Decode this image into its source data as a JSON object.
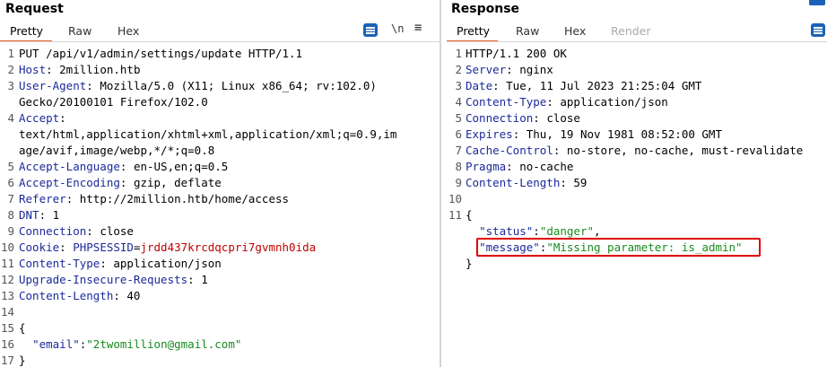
{
  "request": {
    "title": "Request",
    "tabs": [
      "Pretty",
      "Raw",
      "Hex"
    ],
    "active_tab": "Pretty",
    "toolbar": {
      "newline_glyph": "\\n",
      "menu_glyph": "≡",
      "icons": [
        "text-options-icon",
        "newline-toggle-icon",
        "menu-icon"
      ]
    },
    "lines": [
      {
        "n": "1",
        "parts": [
          {
            "t": "PUT /api/v1/admin/settings/update HTTP/1.1",
            "c": "v"
          }
        ]
      },
      {
        "n": "2",
        "parts": [
          {
            "t": "Host",
            "c": "k"
          },
          {
            "t": ": 2million.htb",
            "c": "v"
          }
        ]
      },
      {
        "n": "3",
        "parts": [
          {
            "t": "User-Agent",
            "c": "k"
          },
          {
            "t": ": Mozilla/5.0 (X11; Linux x86_64; rv:102.0)",
            "c": "v"
          }
        ]
      },
      {
        "n": "",
        "parts": [
          {
            "t": "Gecko/20100101 Firefox/102.0",
            "c": "v"
          }
        ]
      },
      {
        "n": "4",
        "parts": [
          {
            "t": "Accept",
            "c": "k"
          },
          {
            "t": ":",
            "c": "v"
          }
        ]
      },
      {
        "n": "",
        "parts": [
          {
            "t": "text/html,application/xhtml+xml,application/xml;q=0.9,im",
            "c": "v"
          }
        ]
      },
      {
        "n": "",
        "parts": [
          {
            "t": "age/avif,image/webp,*/*;q=0.8",
            "c": "v"
          }
        ]
      },
      {
        "n": "5",
        "parts": [
          {
            "t": "Accept-Language",
            "c": "k"
          },
          {
            "t": ": en-US,en;q=0.5",
            "c": "v"
          }
        ]
      },
      {
        "n": "6",
        "parts": [
          {
            "t": "Accept-Encoding",
            "c": "k"
          },
          {
            "t": ": gzip, deflate",
            "c": "v"
          }
        ]
      },
      {
        "n": "7",
        "parts": [
          {
            "t": "Referer",
            "c": "k"
          },
          {
            "t": ": http://2million.htb/home/access",
            "c": "v"
          }
        ]
      },
      {
        "n": "8",
        "parts": [
          {
            "t": "DNT",
            "c": "k"
          },
          {
            "t": ": 1",
            "c": "v"
          }
        ]
      },
      {
        "n": "9",
        "parts": [
          {
            "t": "Connection",
            "c": "k"
          },
          {
            "t": ": close",
            "c": "v"
          }
        ]
      },
      {
        "n": "10",
        "parts": [
          {
            "t": "Cookie",
            "c": "k"
          },
          {
            "t": ": ",
            "c": "v"
          },
          {
            "t": "PHPSESSID",
            "c": "ck"
          },
          {
            "t": "=",
            "c": "v"
          },
          {
            "t": "jrdd437krcdqcpri7gvmnh0ida",
            "c": "cv"
          }
        ]
      },
      {
        "n": "11",
        "parts": [
          {
            "t": "Content-Type",
            "c": "k"
          },
          {
            "t": ": application/json",
            "c": "v"
          }
        ]
      },
      {
        "n": "12",
        "parts": [
          {
            "t": "Upgrade-Insecure-Requests",
            "c": "k"
          },
          {
            "t": ": 1",
            "c": "v"
          }
        ]
      },
      {
        "n": "13",
        "parts": [
          {
            "t": "Content-Length",
            "c": "k"
          },
          {
            "t": ": 40",
            "c": "v"
          }
        ]
      },
      {
        "n": "14",
        "parts": []
      },
      {
        "n": "15",
        "parts": [
          {
            "t": "{",
            "c": "p"
          }
        ]
      },
      {
        "n": "16",
        "parts": [
          {
            "t": "  ",
            "c": "p"
          },
          {
            "t": "\"email\"",
            "c": "jk"
          },
          {
            "t": ":",
            "c": "p"
          },
          {
            "t": "\"2twomillion@gmail.com\"",
            "c": "jv"
          }
        ]
      },
      {
        "n": "17",
        "parts": [
          {
            "t": "}",
            "c": "p"
          }
        ]
      }
    ]
  },
  "response": {
    "title": "Response",
    "tabs": [
      "Pretty",
      "Raw",
      "Hex",
      "Render"
    ],
    "active_tab": "Pretty",
    "disabled_tab": "Render",
    "toolbar": {
      "icons": [
        "text-options-icon"
      ]
    },
    "lines": [
      {
        "n": "1",
        "parts": [
          {
            "t": "HTTP/1.1 200 OK",
            "c": "v"
          }
        ]
      },
      {
        "n": "2",
        "parts": [
          {
            "t": "Server",
            "c": "k"
          },
          {
            "t": ": nginx",
            "c": "v"
          }
        ]
      },
      {
        "n": "3",
        "parts": [
          {
            "t": "Date",
            "c": "k"
          },
          {
            "t": ": Tue, 11 Jul 2023 21:25:04 GMT",
            "c": "v"
          }
        ]
      },
      {
        "n": "4",
        "parts": [
          {
            "t": "Content-Type",
            "c": "k"
          },
          {
            "t": ": application/json",
            "c": "v"
          }
        ]
      },
      {
        "n": "5",
        "parts": [
          {
            "t": "Connection",
            "c": "k"
          },
          {
            "t": ": close",
            "c": "v"
          }
        ]
      },
      {
        "n": "6",
        "parts": [
          {
            "t": "Expires",
            "c": "k"
          },
          {
            "t": ": Thu, 19 Nov 1981 08:52:00 GMT",
            "c": "v"
          }
        ]
      },
      {
        "n": "7",
        "parts": [
          {
            "t": "Cache-Control",
            "c": "k"
          },
          {
            "t": ": no-store, no-cache, must-revalidate",
            "c": "v"
          }
        ]
      },
      {
        "n": "8",
        "parts": [
          {
            "t": "Pragma",
            "c": "k"
          },
          {
            "t": ": no-cache",
            "c": "v"
          }
        ]
      },
      {
        "n": "9",
        "parts": [
          {
            "t": "Content-Length",
            "c": "k"
          },
          {
            "t": ": 59",
            "c": "v"
          }
        ]
      },
      {
        "n": "10",
        "parts": []
      },
      {
        "n": "11",
        "parts": [
          {
            "t": "{",
            "c": "p"
          }
        ]
      },
      {
        "n": "",
        "parts": [
          {
            "t": "  ",
            "c": "p"
          },
          {
            "t": "\"status\"",
            "c": "jk"
          },
          {
            "t": ":",
            "c": "p"
          },
          {
            "t": "\"danger\"",
            "c": "jv"
          },
          {
            "t": ",",
            "c": "p"
          }
        ]
      },
      {
        "n": "",
        "parts": [
          {
            "t": "  ",
            "c": "p"
          },
          {
            "t": "\"message\"",
            "c": "jk"
          },
          {
            "t": ":",
            "c": "p"
          },
          {
            "t": "\"Missing parameter: is_admin\"",
            "c": "jv"
          }
        ],
        "highlight": true
      },
      {
        "n": "",
        "parts": [
          {
            "t": "}",
            "c": "p"
          }
        ]
      }
    ]
  },
  "colors": {
    "accent": "#e8642d",
    "icon_blue": "#1b62b6",
    "highlight_border": "#e00000",
    "header_key": "#1b2a9a",
    "json_string": "#178c1e",
    "cookie_value": "#c00000"
  }
}
